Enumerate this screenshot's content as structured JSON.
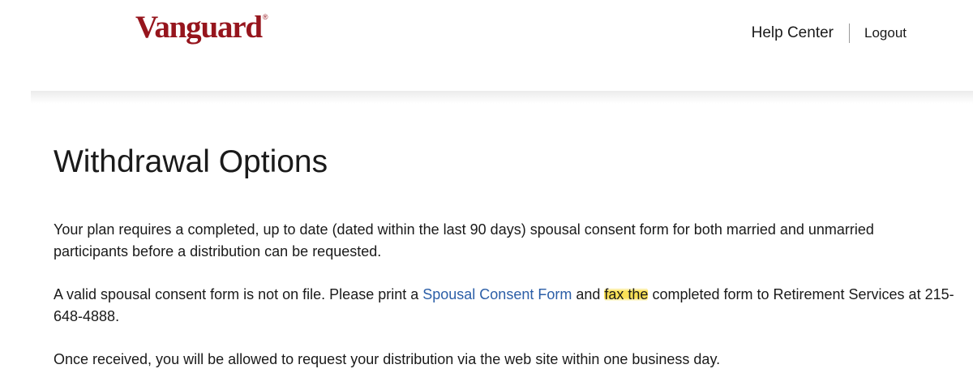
{
  "header": {
    "logo_text": "Vanguard",
    "logo_mark": "®",
    "help_label": "Help Center",
    "logout_label": "Logout",
    "brand_color": "#96151d"
  },
  "main": {
    "title": "Withdrawal Options",
    "para1": "Your plan requires a completed, up to date (dated within the last 90 days) spousal consent form for both married and unmarried participants before a distribution can be requested.",
    "para2": {
      "before_link": "A valid spousal consent form is not on file. Please print a ",
      "link_label": "Spousal Consent Form",
      "after_link_1": " and ",
      "highlighted": "fax the",
      "after_link_2": " completed form to Retirement Services at 215-648-4888."
    },
    "para3": "Once received, you will be allowed to request your distribution via the web site within one business day.",
    "link_color": "#2b5ea7",
    "highlight_color": "#fbe156"
  }
}
